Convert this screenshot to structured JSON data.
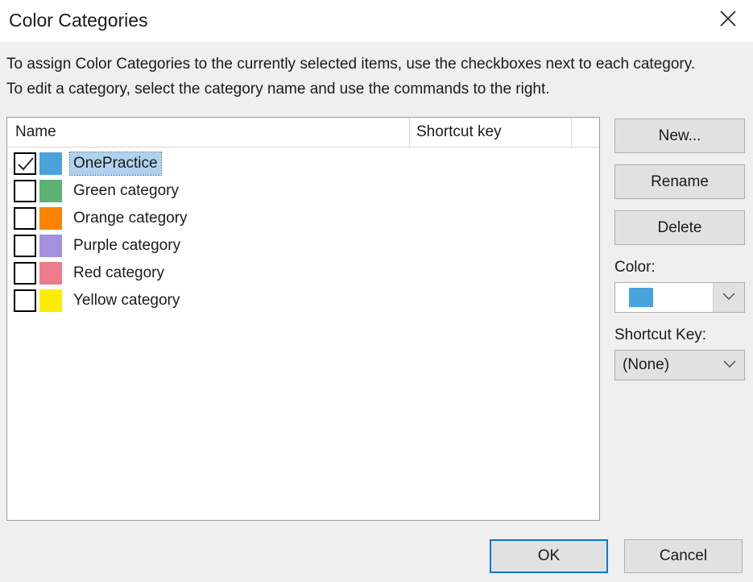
{
  "dialog": {
    "title": "Color Categories",
    "close_icon": "close-icon",
    "instructions": "To assign Color Categories to the currently selected items, use the checkboxes next to each category.  To edit a category, select the category name and use the commands to the right."
  },
  "list": {
    "columns": {
      "name": "Name",
      "shortcut_key": "Shortcut key"
    },
    "rows": [
      {
        "name": "OnePractice",
        "color": "#4aa3dc",
        "checked": true,
        "selected": true,
        "shortcut": ""
      },
      {
        "name": "Green category",
        "color": "#5cb173",
        "checked": false,
        "selected": false,
        "shortcut": ""
      },
      {
        "name": "Orange category",
        "color": "#fc8401",
        "checked": false,
        "selected": false,
        "shortcut": ""
      },
      {
        "name": "Purple category",
        "color": "#a391de",
        "checked": false,
        "selected": false,
        "shortcut": ""
      },
      {
        "name": "Red category",
        "color": "#ec7c8b",
        "checked": false,
        "selected": false,
        "shortcut": ""
      },
      {
        "name": "Yellow category",
        "color": "#fdec00",
        "checked": false,
        "selected": false,
        "shortcut": ""
      }
    ]
  },
  "side_panel": {
    "new_label": "New...",
    "rename_label": "Rename",
    "delete_label": "Delete",
    "color_label": "Color:",
    "color_value": "#4aa3dc",
    "shortcut_label": "Shortcut Key:",
    "shortcut_value": "(None)"
  },
  "footer": {
    "ok_label": "OK",
    "cancel_label": "Cancel"
  },
  "theme": {
    "accent": "#0078d7",
    "dialog_bg": "#efefef",
    "titlebar_bg": "#ffffff",
    "selection_bg": "#aed3ef",
    "button_bg": "#e1e1e1",
    "button_border": "#adadad"
  }
}
